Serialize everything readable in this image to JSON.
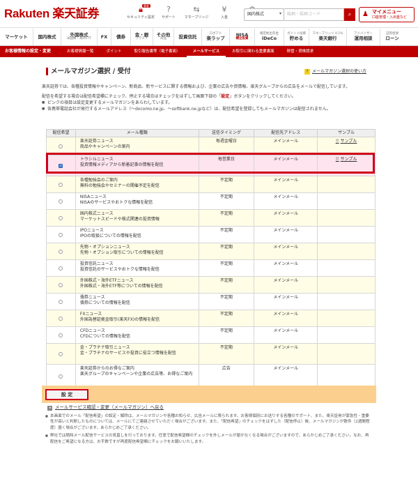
{
  "header": {
    "logo": "Rakuten 楽天証券",
    "icons": [
      {
        "label": "セキュリティ設定",
        "icon": "lock-icon",
        "badge": "重要"
      },
      {
        "label": "サポート",
        "icon": "question-icon"
      },
      {
        "label": "マネーブリッジ",
        "icon": "bridge-icon"
      },
      {
        "label": "入金",
        "icon": "deposit-icon"
      },
      {
        "label": "設定",
        "icon": "gear-icon"
      }
    ],
    "search_scope": "国内株式",
    "search_placeholder": "銘柄・銘柄コード",
    "mymenu_label": "マイメニュー",
    "mymenu_sub": "口座管理・入出金など"
  },
  "gnav": [
    {
      "label": "マーケット",
      "sub": ""
    },
    {
      "label": "国内株式",
      "sub": ""
    },
    {
      "label": "外国株式",
      "sub": "米国株・海外ETF"
    },
    {
      "label": "FX",
      "sub": ""
    },
    {
      "label": "債券",
      "sub": ""
    },
    {
      "label": "金・銀",
      "sub": "プラチナ"
    },
    {
      "label": "その他",
      "sub": "商品"
    },
    {
      "label": "投資信託",
      "sub": ""
    },
    {
      "label": "楽ラップ",
      "sub": "ロボアド"
    },
    {
      "label": "NISA",
      "sub": "積立投資"
    },
    {
      "label": "iDeCo",
      "sub": "確定拠出年金"
    },
    {
      "label": "貯める",
      "sub": "ポイント投資"
    },
    {
      "label": "楽天銀行",
      "sub": "マネーブリッジ 0.1%"
    },
    {
      "label": "運用相談",
      "sub": "アドバイザー"
    },
    {
      "label": "ローン",
      "sub": "証券担保"
    }
  ],
  "subnav": {
    "title": "お客様情報の設定・変更",
    "tabs": [
      "お客様情報一覧",
      "ポイント",
      "取引報告書等（電子書面）",
      "メールサービス",
      "お取引に関わる重要書面",
      "移管・貸株請求"
    ],
    "active": "メールサービス"
  },
  "page": {
    "title": "メールマガジン選択 / 受付",
    "help_link": "メールマガジン選択の使い方"
  },
  "intro": {
    "p1": "楽天証券では、各種投資情報やキャンペーン、新商品、新サービスに関する情報および、企業の広告や資情報、楽天グループからの広告をメールで配信しています。",
    "p2_prefix": "配信を希望する場合は配信希望欄にチェック、停止する場合はチェックをはずして画面下部の「",
    "p2_highlight": "設定",
    "p2_suffix": "」ボタンをクリックしてください。",
    "bullets": [
      "ピンクの項目は設定変更するメールマガジンをあらわしています。",
      "各携帯電話会社が発行するメールアドレス（～docomo.ne.jp、～softbank.ne.jpなど）は、配信希望を登録してもメールマガジンは配信されません。"
    ]
  },
  "table": {
    "headers": [
      "配信希望",
      "メール種類",
      "送信タイミング",
      "配信先アドレス",
      "サンプル"
    ],
    "rows": [
      {
        "checked": false,
        "name": "楽天証券ニュース",
        "desc": "商品やキャンペーンの案内",
        "timing": "毎週金曜日",
        "address": "メインメール",
        "sample": "サンプル"
      },
      {
        "checked": true,
        "name": "トウシルニュース",
        "desc": "投資情報メディアから新着記事の情報を配信",
        "timing": "毎営業日",
        "address": "メインメール",
        "sample": "サンプル"
      },
      {
        "checked": false,
        "name": "各種勉強会のご案内",
        "desc": "無料の勉強会やセミナーの開催予定を配信",
        "timing": "不定期",
        "address": "メインメール",
        "sample": ""
      },
      {
        "checked": false,
        "name": "NISAニュース",
        "desc": "NISAのサービスやおトクな情報を配信",
        "timing": "不定期",
        "address": "メインメール",
        "sample": ""
      },
      {
        "checked": false,
        "name": "国内株式ニュース",
        "desc": "マーケットスピードや株式関連の投資情報",
        "timing": "不定期",
        "address": "メインメール",
        "sample": ""
      },
      {
        "checked": false,
        "name": "IPOニュース",
        "desc": "IPOの取扱についての情報を配信",
        "timing": "不定期",
        "address": "メインメール",
        "sample": ""
      },
      {
        "checked": false,
        "name": "先物・オプションニュース",
        "desc": "先物・オプション取引についての情報を配信",
        "timing": "不定期",
        "address": "メインメール",
        "sample": ""
      },
      {
        "checked": false,
        "name": "投資信託ニュース",
        "desc": "投資信託のサービスやおトクな情報を配信",
        "timing": "不定期",
        "address": "メインメール",
        "sample": ""
      },
      {
        "checked": false,
        "name": "外国株式・海外ETFニュース",
        "desc": "外国株式・海外ETF等についての情報を配信",
        "timing": "不定期",
        "address": "メインメール",
        "sample": ""
      },
      {
        "checked": false,
        "name": "債券ニュース",
        "desc": "債券についての情報を配信",
        "timing": "不定期",
        "address": "メインメール",
        "sample": ""
      },
      {
        "checked": false,
        "name": "FXニュース",
        "desc": "外国為替証拠金取引(楽天FX)の情報を配信",
        "timing": "不定期",
        "address": "メインメール",
        "sample": ""
      },
      {
        "checked": false,
        "name": "CFDニュース",
        "desc": "CFDについての情報を配信",
        "timing": "不定期",
        "address": "メインメール",
        "sample": ""
      },
      {
        "checked": false,
        "name": "金・プラチナ取引ニュース",
        "desc": "金・プラチナのサービスや投資に役立つ情報を配信",
        "timing": "不定期",
        "address": "メインメール",
        "sample": ""
      },
      {
        "checked": false,
        "name": "楽天証券からのお得なご案内",
        "desc": "楽天グループのキャンペーンや企業の広告等、お得なご案内",
        "timing": "広告",
        "address": "メインメール",
        "sample": ""
      }
    ]
  },
  "footer": {
    "set_button": "設 定",
    "back_link": "メールサービス確認・変更（メールマガジン）へ戻る",
    "notes": [
      "本画面でのメール「配信希望」の設定・解除は、メールマガジンや各種お知らせ、広告メールに限られます。お客様個別にお送りする各種のサポート、また、楽天証券が緊急性・重要性が高いと判断したものについては、メールにてご連絡させていただく場合がございます。また、「配信希望」のチェックをはずした（配信停止）後、メールマガジンが数件（2週間程度）届く場合がございます。あらかじめご了承ください。",
      "弊社では随時メール配信サービスの見直しを行っております。任意で配信希望欄のチェックを外しメールが届かなくなる場合がございますので、あらかじめご了承ください。なお、再配信をご希望になる方は、お手数ですが再度配信希望欄にチェックをお願いいたします。"
    ]
  },
  "colors": {
    "brand": "#bf0000",
    "highlight_border": "#d0001a",
    "selected_row": "#fde4ee",
    "row_alt": "#fffde6",
    "set_bar": "#fbd08e"
  }
}
